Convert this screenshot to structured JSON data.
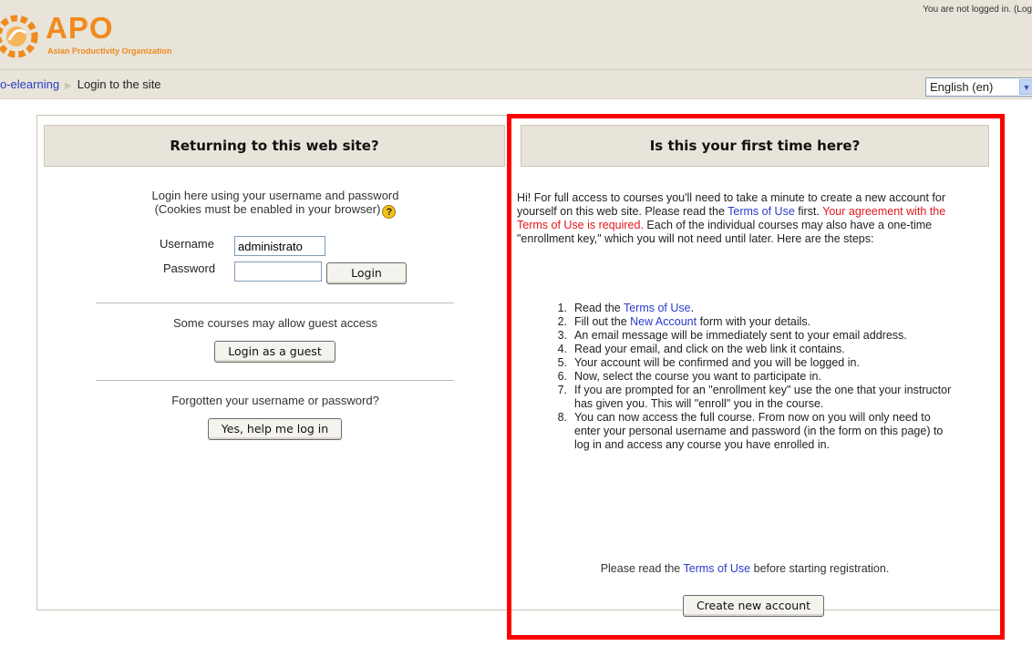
{
  "header": {
    "logo_text": "APO",
    "logo_subtitle": "Asian Productivity Organization",
    "login_info": "You are not logged in. (Log"
  },
  "navbar": {
    "breadcrumb_home": "o-elearning",
    "breadcrumb_current": "Login to the site",
    "language": "English (en)"
  },
  "login_panel": {
    "title": "Returning to this web site?",
    "intro_line1": "Login here using your username and password",
    "intro_line2": "(Cookies must be enabled in your browser)",
    "username_label": "Username",
    "username_value": "administrato",
    "password_label": "Password",
    "password_value": "",
    "login_button": "Login",
    "guest_text": "Some courses may allow guest access",
    "guest_button": "Login as a guest",
    "forgot_text": "Forgotten your username or password?",
    "forgot_button": "Yes, help me log in"
  },
  "signup_panel": {
    "title": "Is this your first time here?",
    "intro_part1": "Hi! For full access to courses you'll need to take a minute to create a new account for yourself on this web site. Please read the ",
    "terms_link": "Terms of Use",
    "intro_part2": " first. ",
    "requirement": "Your agreement with the Terms of Use is required.",
    "intro_part3": " Each of the individual courses may also have a one-time \"enrollment key,\" which you will not need until later. Here are the steps:",
    "steps": [
      {
        "num": "1.",
        "pre": "Read the ",
        "link": "Terms of Use",
        "post": "."
      },
      {
        "num": "2.",
        "pre": "Fill out the ",
        "link": "New Account",
        "post": " form with your details."
      },
      {
        "num": "3.",
        "text": "An email message will be immediately sent to your email address."
      },
      {
        "num": "4.",
        "text": "Read your email, and click on the web link it contains."
      },
      {
        "num": "5.",
        "text": "Your account will be confirmed and you will be logged in."
      },
      {
        "num": "6.",
        "text": "Now, select the course you want to participate in."
      },
      {
        "num": "7.",
        "text": "If you are prompted for an \"enrollment key\" use the one that your instructor has given you. This will \"enroll\" you in the course."
      },
      {
        "num": "8.",
        "text": "You can now access the full course. From now on you will only need to enter your personal username and password (in the form on this page) to log in and access any course you have enrolled in."
      }
    ],
    "footer_pre": "Please read the ",
    "footer_link": "Terms of Use",
    "footer_post": " before starting registration.",
    "create_button": "Create new account"
  },
  "colors": {
    "logo": "#f08a1c",
    "header_bg": "#e8e4d9",
    "link": "#2a3cc9",
    "required_text": "#e0181d",
    "highlight_box": "#ff0000"
  },
  "icons": {
    "logo": "apo-gear-logo",
    "help": "question-help-icon",
    "breadcrumb_separator": "triangle-right-icon",
    "dropdown": "chevron-down-icon"
  }
}
